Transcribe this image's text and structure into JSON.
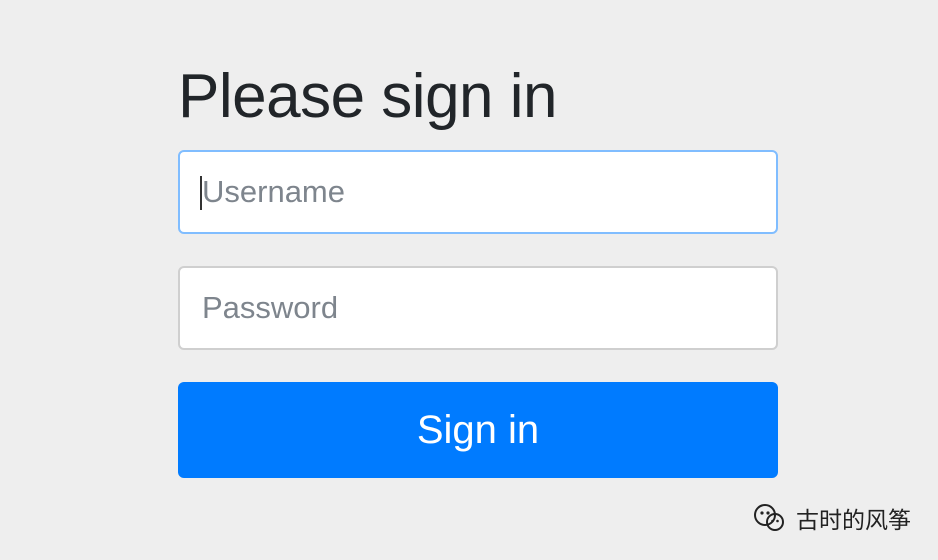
{
  "page": {
    "title": "Please sign in"
  },
  "login": {
    "username_placeholder": "Username",
    "password_placeholder": "Password",
    "submit_label": "Sign in"
  },
  "watermark": {
    "text": "古时的风筝",
    "icon": "wechat-icon"
  },
  "colors": {
    "background": "#eeeeee",
    "primary": "#007bff",
    "focus_border": "#80bdff",
    "text": "#212529"
  }
}
